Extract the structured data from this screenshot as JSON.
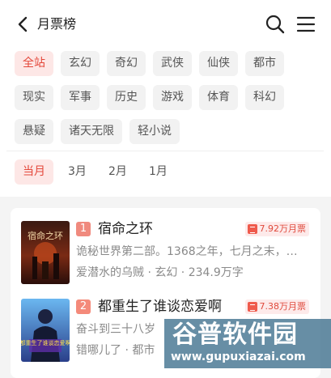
{
  "header": {
    "title": "月票榜",
    "back_icon": "chevron-left-icon",
    "search_icon": "search-icon",
    "menu_icon": "hamburger-menu-icon"
  },
  "categories": [
    "全站",
    "玄幻",
    "奇幻",
    "武侠",
    "仙侠",
    "都市",
    "现实",
    "军事",
    "历史",
    "游戏",
    "体育",
    "科幻",
    "悬疑",
    "诸天无限",
    "轻小说"
  ],
  "categories_selected": "全站",
  "time_filters": [
    "当月",
    "3月",
    "2月",
    "1月"
  ],
  "time_selected": "当月",
  "books": [
    {
      "rank": "1",
      "name": "宿命之环",
      "votes": "7.92万月票",
      "desc": "诡秘世界第二部。1368之年，七月之末，…",
      "meta": "爱潜水的乌贼 · 玄幻 · 234.9万字",
      "cover_text": "宿命之环"
    },
    {
      "rank": "2",
      "name": "都重生了谁谈恋爱啊",
      "votes": "7.38万月票",
      "desc": "奋斗到三十八岁",
      "meta": "错哪儿了 · 都市",
      "cover_text": "都重生了谁谈恋爱啊"
    }
  ],
  "watermark": {
    "title": "谷普软件园",
    "url": "www.gupuxiazai.com"
  },
  "colors": {
    "accent": "#e4473a",
    "accent_bg": "#fde7e6",
    "chip_bg": "#f2f2f2",
    "page_bg": "#f4f4f4"
  }
}
